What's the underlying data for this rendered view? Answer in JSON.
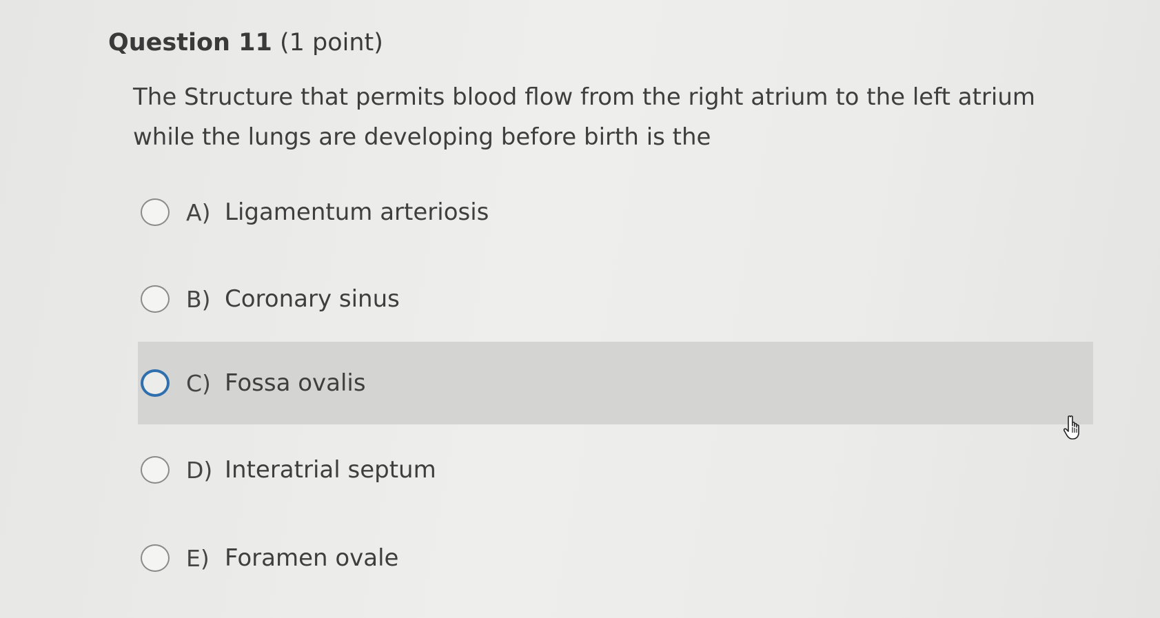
{
  "question": {
    "title": "Question 11",
    "points": "(1 point)",
    "text": "The Structure that permits blood flow from the right atrium to the left atrium while the lungs are developing before birth is the"
  },
  "options": [
    {
      "letter": "A)",
      "label": "Ligamentum arteriosis",
      "selected": false
    },
    {
      "letter": "B)",
      "label": "Coronary sinus",
      "selected": false
    },
    {
      "letter": "C)",
      "label": "Fossa ovalis",
      "selected": true
    },
    {
      "letter": "D)",
      "label": "Interatrial septum",
      "selected": false
    },
    {
      "letter": "E)",
      "label": "Foramen ovale",
      "selected": false
    }
  ],
  "colors": {
    "selected_ring": "#2f6fae",
    "highlight_row": "#d4d4d2",
    "background": "#e9e9e7"
  },
  "icons": {
    "cursor": "hand-pointer-icon"
  }
}
